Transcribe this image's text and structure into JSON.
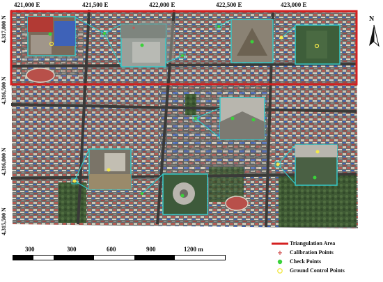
{
  "x_axis": {
    "ticks": [
      "421,000 E",
      "421,500 E",
      "422,000 E",
      "422,500 E",
      "423,000 E"
    ]
  },
  "y_axis": {
    "ticks": [
      "4,317,000 N",
      "4,316,500 N",
      "4,316,000 N",
      "4,315,500 N"
    ]
  },
  "north_arrow": {
    "label": "N",
    "icon": "north-arrow-icon"
  },
  "scale_bar": {
    "labels": [
      "300",
      "300",
      "600",
      "900",
      "1200 m"
    ]
  },
  "legend": {
    "items": [
      {
        "label": "Triangulation Area",
        "symbol": "red-line",
        "color": "#d42020"
      },
      {
        "label": "Calibration Points",
        "symbol": "plus",
        "color": "#d05050"
      },
      {
        "label": "Check Points",
        "symbol": "circle",
        "color": "#3ad23a"
      },
      {
        "label": "Ground Control Points",
        "symbol": "circle",
        "color": "#f2e84a"
      }
    ]
  },
  "colors": {
    "triangulation": "#d42020",
    "inset_border": "#34c8c8",
    "check_point": "#3ad23a",
    "gcp": "#f2e84a"
  }
}
